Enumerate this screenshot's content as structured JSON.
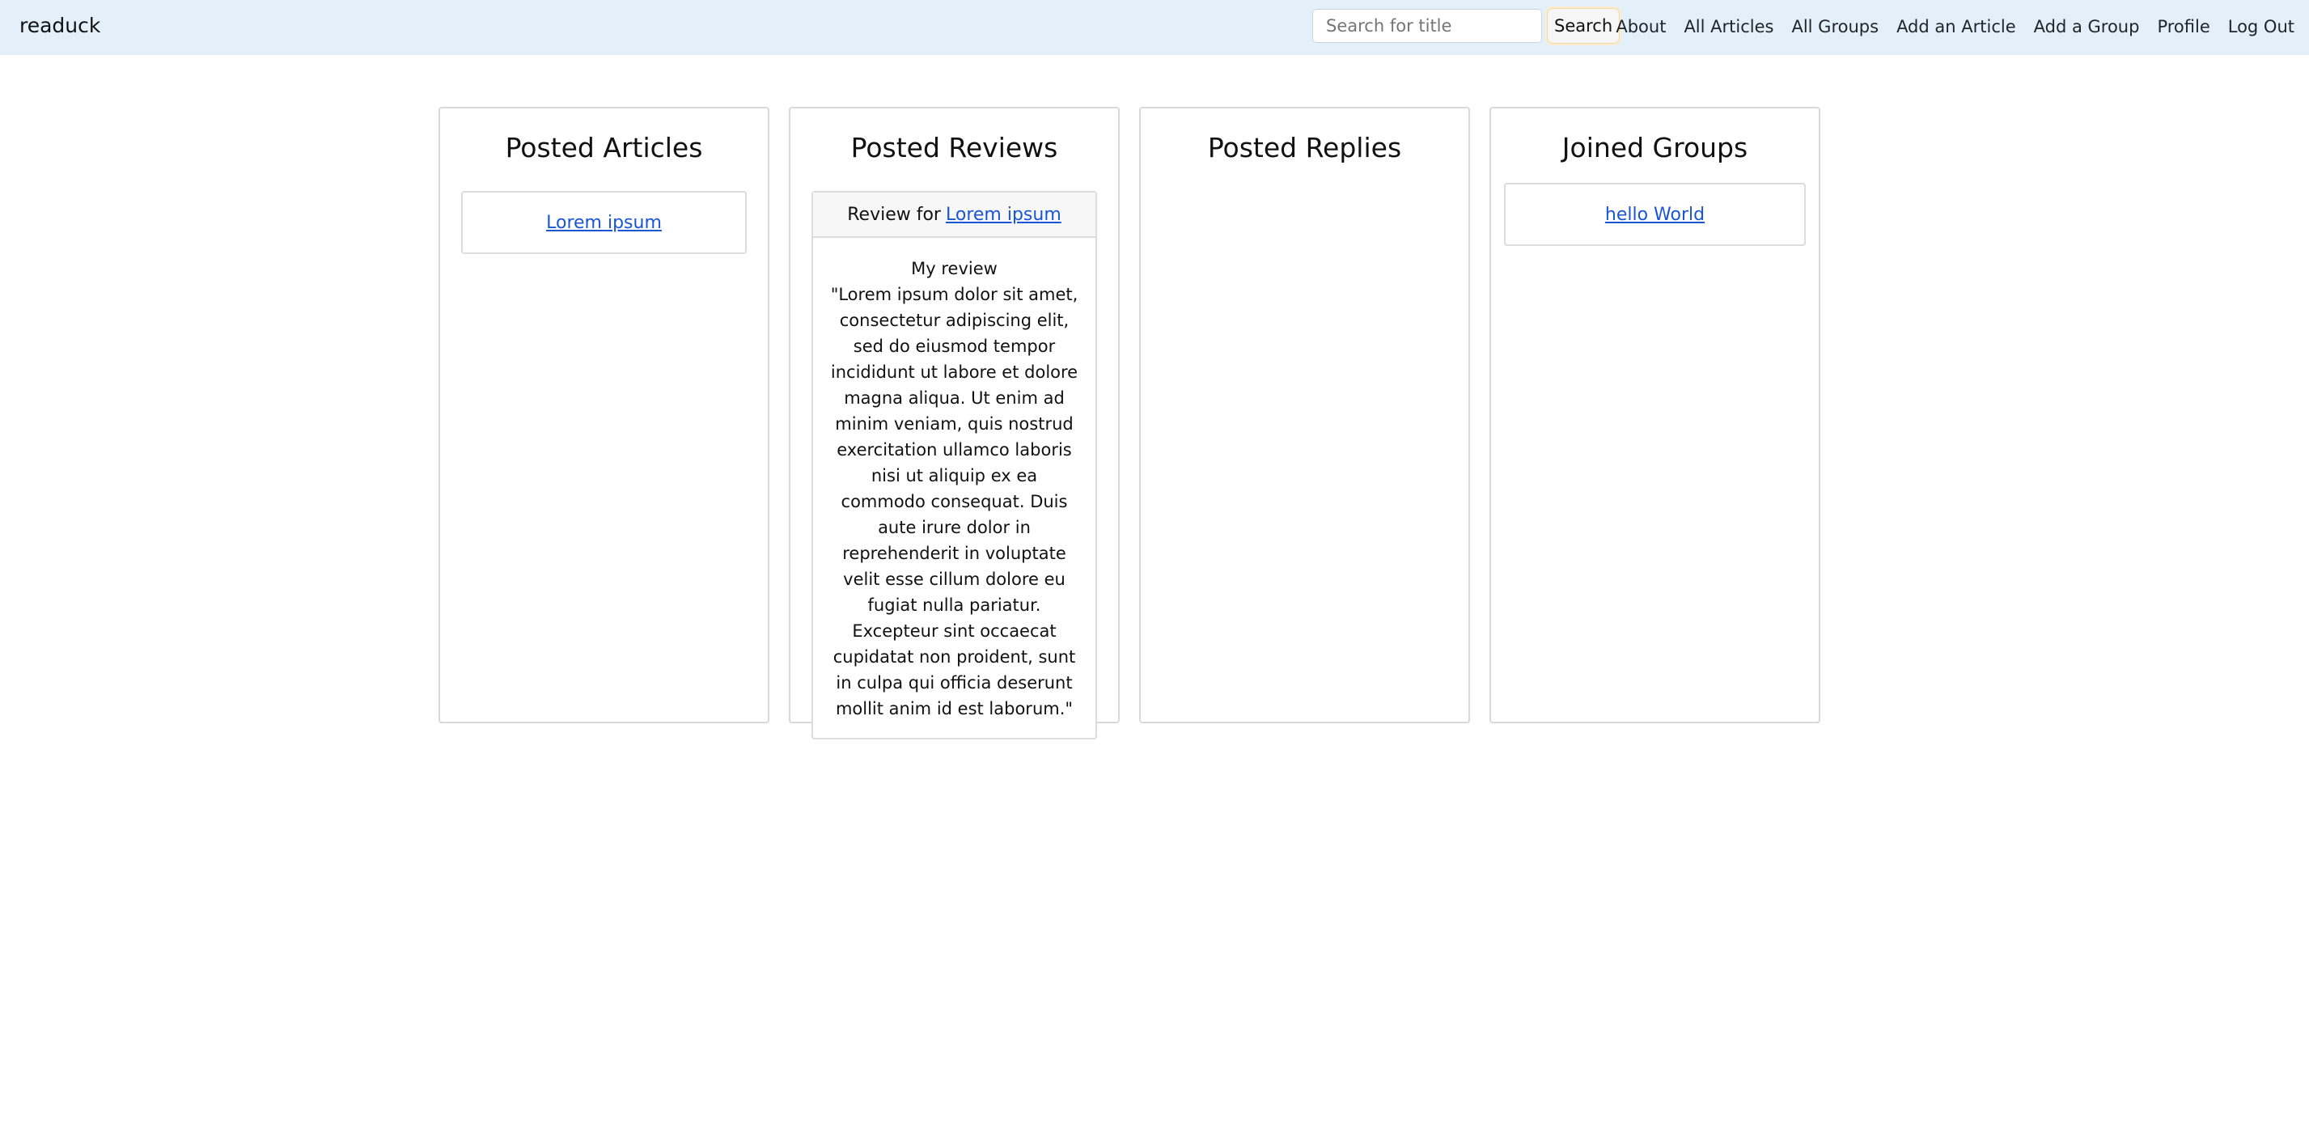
{
  "navbar": {
    "brand": "readuck",
    "search": {
      "placeholder": "Search for title",
      "value": "",
      "button_label": "Search"
    },
    "links": [
      "About",
      "All Articles",
      "All Groups",
      "Add an Article",
      "Add a Group",
      "Profile",
      "Log Out"
    ]
  },
  "columns": {
    "articles": {
      "title": "Posted Articles",
      "items": [
        {
          "label": "Lorem ipsum"
        }
      ]
    },
    "reviews": {
      "title": "Posted Reviews",
      "items": [
        {
          "prefix": "Review for",
          "article_label": "Lorem ipsum",
          "review_title": "My review",
          "review_text": "\"Lorem ipsum dolor sit amet, consectetur adipiscing elit, sed do eiusmod tempor incididunt ut labore et dolore magna aliqua. Ut enim ad minim veniam, quis nostrud exercitation ullamco laboris nisi ut aliquip ex ea commodo consequat. Duis aute irure dolor in reprehenderit in voluptate velit esse cillum dolore eu fugiat nulla pariatur. Excepteur sint occaecat cupidatat non proident, sunt in culpa qui officia deserunt mollit anim id est laborum.\""
        }
      ]
    },
    "replies": {
      "title": "Posted Replies",
      "items": []
    },
    "groups": {
      "title": "Joined Groups",
      "items": [
        {
          "label": "hello World"
        }
      ]
    }
  }
}
